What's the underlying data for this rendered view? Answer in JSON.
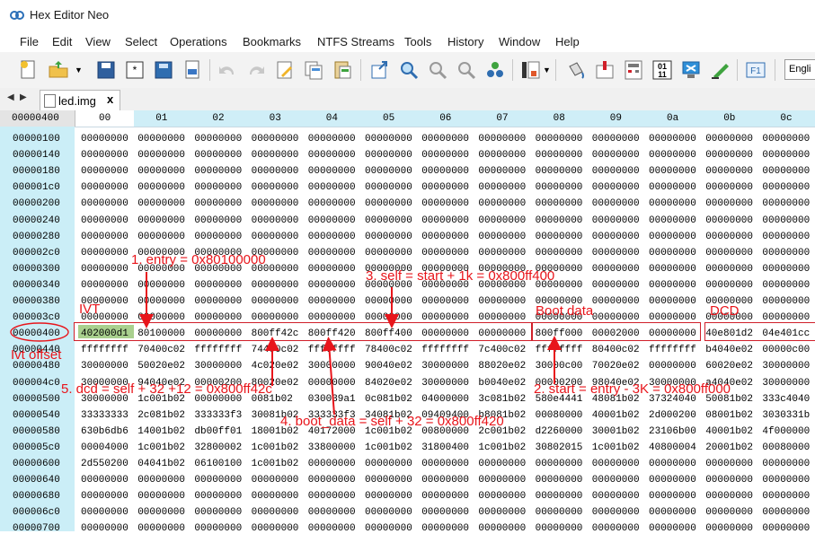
{
  "window": {
    "title": "Hex Editor Neo"
  },
  "menu": [
    "File",
    "Edit",
    "View",
    "Select",
    "Operations",
    "Bookmarks",
    "NTFS Streams",
    "Tools",
    "History",
    "Window",
    "Help"
  ],
  "toolbar": {
    "language": "Engli"
  },
  "tabs": {
    "prev": "◀",
    "next": "▶",
    "active": "led.img",
    "close": "x"
  },
  "hex": {
    "corner_offset": "00000400",
    "columns": [
      "00",
      "01",
      "02",
      "03",
      "04",
      "05",
      "06",
      "07",
      "08",
      "09",
      "0a",
      "0b",
      "0c"
    ],
    "rows": [
      {
        "offset": "00000100",
        "cells": [
          "00000000",
          "00000000",
          "00000000",
          "00000000",
          "00000000",
          "00000000",
          "00000000",
          "00000000",
          "00000000",
          "00000000",
          "00000000",
          "00000000",
          "00000000"
        ]
      },
      {
        "offset": "00000140",
        "cells": [
          "00000000",
          "00000000",
          "00000000",
          "00000000",
          "00000000",
          "00000000",
          "00000000",
          "00000000",
          "00000000",
          "00000000",
          "00000000",
          "00000000",
          "00000000"
        ]
      },
      {
        "offset": "00000180",
        "cells": [
          "00000000",
          "00000000",
          "00000000",
          "00000000",
          "00000000",
          "00000000",
          "00000000",
          "00000000",
          "00000000",
          "00000000",
          "00000000",
          "00000000",
          "00000000"
        ]
      },
      {
        "offset": "000001c0",
        "cells": [
          "00000000",
          "00000000",
          "00000000",
          "00000000",
          "00000000",
          "00000000",
          "00000000",
          "00000000",
          "00000000",
          "00000000",
          "00000000",
          "00000000",
          "00000000"
        ]
      },
      {
        "offset": "00000200",
        "cells": [
          "00000000",
          "00000000",
          "00000000",
          "00000000",
          "00000000",
          "00000000",
          "00000000",
          "00000000",
          "00000000",
          "00000000",
          "00000000",
          "00000000",
          "00000000"
        ]
      },
      {
        "offset": "00000240",
        "cells": [
          "00000000",
          "00000000",
          "00000000",
          "00000000",
          "00000000",
          "00000000",
          "00000000",
          "00000000",
          "00000000",
          "00000000",
          "00000000",
          "00000000",
          "00000000"
        ]
      },
      {
        "offset": "00000280",
        "cells": [
          "00000000",
          "00000000",
          "00000000",
          "00000000",
          "00000000",
          "00000000",
          "00000000",
          "00000000",
          "00000000",
          "00000000",
          "00000000",
          "00000000",
          "00000000"
        ]
      },
      {
        "offset": "000002c0",
        "cells": [
          "00000000",
          "00000000",
          "00000000",
          "00000000",
          "00000000",
          "00000000",
          "00000000",
          "00000000",
          "00000000",
          "00000000",
          "00000000",
          "00000000",
          "00000000"
        ]
      },
      {
        "offset": "00000300",
        "cells": [
          "00000000",
          "00000000",
          "00000000",
          "00000000",
          "00000000",
          "00000000",
          "00000000",
          "00000000",
          "00000000",
          "00000000",
          "00000000",
          "00000000",
          "00000000"
        ]
      },
      {
        "offset": "00000340",
        "cells": [
          "00000000",
          "00000000",
          "00000000",
          "00000000",
          "00000000",
          "00000000",
          "00000000",
          "00000000",
          "00000000",
          "00000000",
          "00000000",
          "00000000",
          "00000000"
        ]
      },
      {
        "offset": "00000380",
        "cells": [
          "00000000",
          "00000000",
          "00000000",
          "00000000",
          "00000000",
          "00000000",
          "00000000",
          "00000000",
          "00000000",
          "00000000",
          "00000000",
          "00000000",
          "00000000"
        ]
      },
      {
        "offset": "000003c0",
        "cells": [
          "00000000",
          "00000000",
          "00000000",
          "00000000",
          "00000000",
          "00000000",
          "00000000",
          "00000000",
          "00000000",
          "00000000",
          "00000000",
          "00000000",
          "00000000"
        ]
      },
      {
        "offset": "00000400",
        "cells": [
          "402000d1",
          "80100000",
          "00000000",
          "800ff42c",
          "800ff420",
          "800ff400",
          "00000000",
          "00000000",
          "800ff000",
          "00002000",
          "00000000",
          "40e801d2",
          "04e401cc"
        ]
      },
      {
        "offset": "00000440",
        "cells": [
          "ffffffff",
          "70400c02",
          "ffffffff",
          "74400c02",
          "ffffffff",
          "78400c02",
          "ffffffff",
          "7c400c02",
          "ffffffff",
          "80400c02",
          "ffffffff",
          "b4040e02",
          "00000c00"
        ]
      },
      {
        "offset": "00000480",
        "cells": [
          "30000000",
          "50020e02",
          "30000000",
          "4c020e02",
          "30000000",
          "90040e02",
          "30000000",
          "88020e02",
          "30000c00",
          "70020e02",
          "00000000",
          "60020e02",
          "30000000"
        ]
      },
      {
        "offset": "000004c0",
        "cells": [
          "30000000",
          "94040e02",
          "00000200",
          "80020e02",
          "00000000",
          "84020e02",
          "30000000",
          "b0040e02",
          "00000200",
          "98040e02",
          "30000000",
          "a4040e02",
          "30000000"
        ]
      },
      {
        "offset": "00000500",
        "cells": [
          "30000000",
          "1c001b02",
          "00000000",
          "0081b02",
          "030039a1",
          "0c081b02",
          "04000000",
          "3c081b02",
          "580e4441",
          "48081b02",
          "37324040",
          "50081b02",
          "333c4040"
        ]
      },
      {
        "offset": "00000540",
        "cells": [
          "33333333",
          "2c081b02",
          "333333f3",
          "30081b02",
          "333333f3",
          "34081b02",
          "09409400",
          "b8081b02",
          "00080000",
          "40001b02",
          "2d000200",
          "08001b02",
          "3030331b"
        ]
      },
      {
        "offset": "00000580",
        "cells": [
          "630b6db6",
          "14001b02",
          "db00ff01",
          "18001b02",
          "40172000",
          "1c001b02",
          "00800000",
          "2c001b02",
          "d2260000",
          "30001b02",
          "23106b00",
          "40001b02",
          "4f000000"
        ]
      },
      {
        "offset": "000005c0",
        "cells": [
          "00004000",
          "1c001b02",
          "32800002",
          "1c001b02",
          "33800000",
          "1c001b02",
          "31800400",
          "1c001b02",
          "30802015",
          "1c001b02",
          "40800004",
          "20001b02",
          "00080000"
        ]
      },
      {
        "offset": "00000600",
        "cells": [
          "2d550200",
          "04041b02",
          "06100100",
          "1c001b02",
          "00000000",
          "00000000",
          "00000000",
          "00000000",
          "00000000",
          "00000000",
          "00000000",
          "00000000",
          "00000000"
        ]
      },
      {
        "offset": "00000640",
        "cells": [
          "00000000",
          "00000000",
          "00000000",
          "00000000",
          "00000000",
          "00000000",
          "00000000",
          "00000000",
          "00000000",
          "00000000",
          "00000000",
          "00000000",
          "00000000"
        ]
      },
      {
        "offset": "00000680",
        "cells": [
          "00000000",
          "00000000",
          "00000000",
          "00000000",
          "00000000",
          "00000000",
          "00000000",
          "00000000",
          "00000000",
          "00000000",
          "00000000",
          "00000000",
          "00000000"
        ]
      },
      {
        "offset": "000006c0",
        "cells": [
          "00000000",
          "00000000",
          "00000000",
          "00000000",
          "00000000",
          "00000000",
          "00000000",
          "00000000",
          "00000000",
          "00000000",
          "00000000",
          "00000000",
          "00000000"
        ]
      },
      {
        "offset": "00000700",
        "cells": [
          "00000000",
          "00000000",
          "00000000",
          "00000000",
          "00000000",
          "00000000",
          "00000000",
          "00000000",
          "00000000",
          "00000000",
          "00000000",
          "00000000",
          "00000000"
        ]
      }
    ]
  },
  "annotations": {
    "entry": "1. entry = 0x80100000",
    "start": "2. start = entry - 3K = 0x800ff000",
    "self": "3. self = start + 1k = 0x800ff400",
    "boot_data": "4. boot_data = self + 32 = 0x800ff420",
    "dcd": "5. dcd = self + 32 +12 = 0x800ff42c",
    "ivt": "IVT",
    "ivt_offset": "Ivt offset",
    "boot_data_label": "Boot data",
    "dcd_label": "DCD"
  },
  "colors": {
    "annotation": "#e8151b",
    "offset_bg": "#cbeef7",
    "ivt_highlight": "#a9d08e"
  }
}
